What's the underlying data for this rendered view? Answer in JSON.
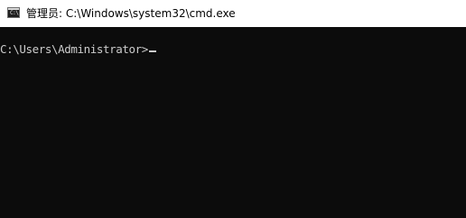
{
  "window": {
    "title": "管理员: C:\\Windows\\system32\\cmd.exe",
    "icon": "cmd-console-icon",
    "icon_glyph": "C:\\"
  },
  "console": {
    "prompt": "C:\\Users\\Administrator>",
    "input_value": "",
    "background": "#0c0c0c",
    "foreground": "#cccccc"
  }
}
